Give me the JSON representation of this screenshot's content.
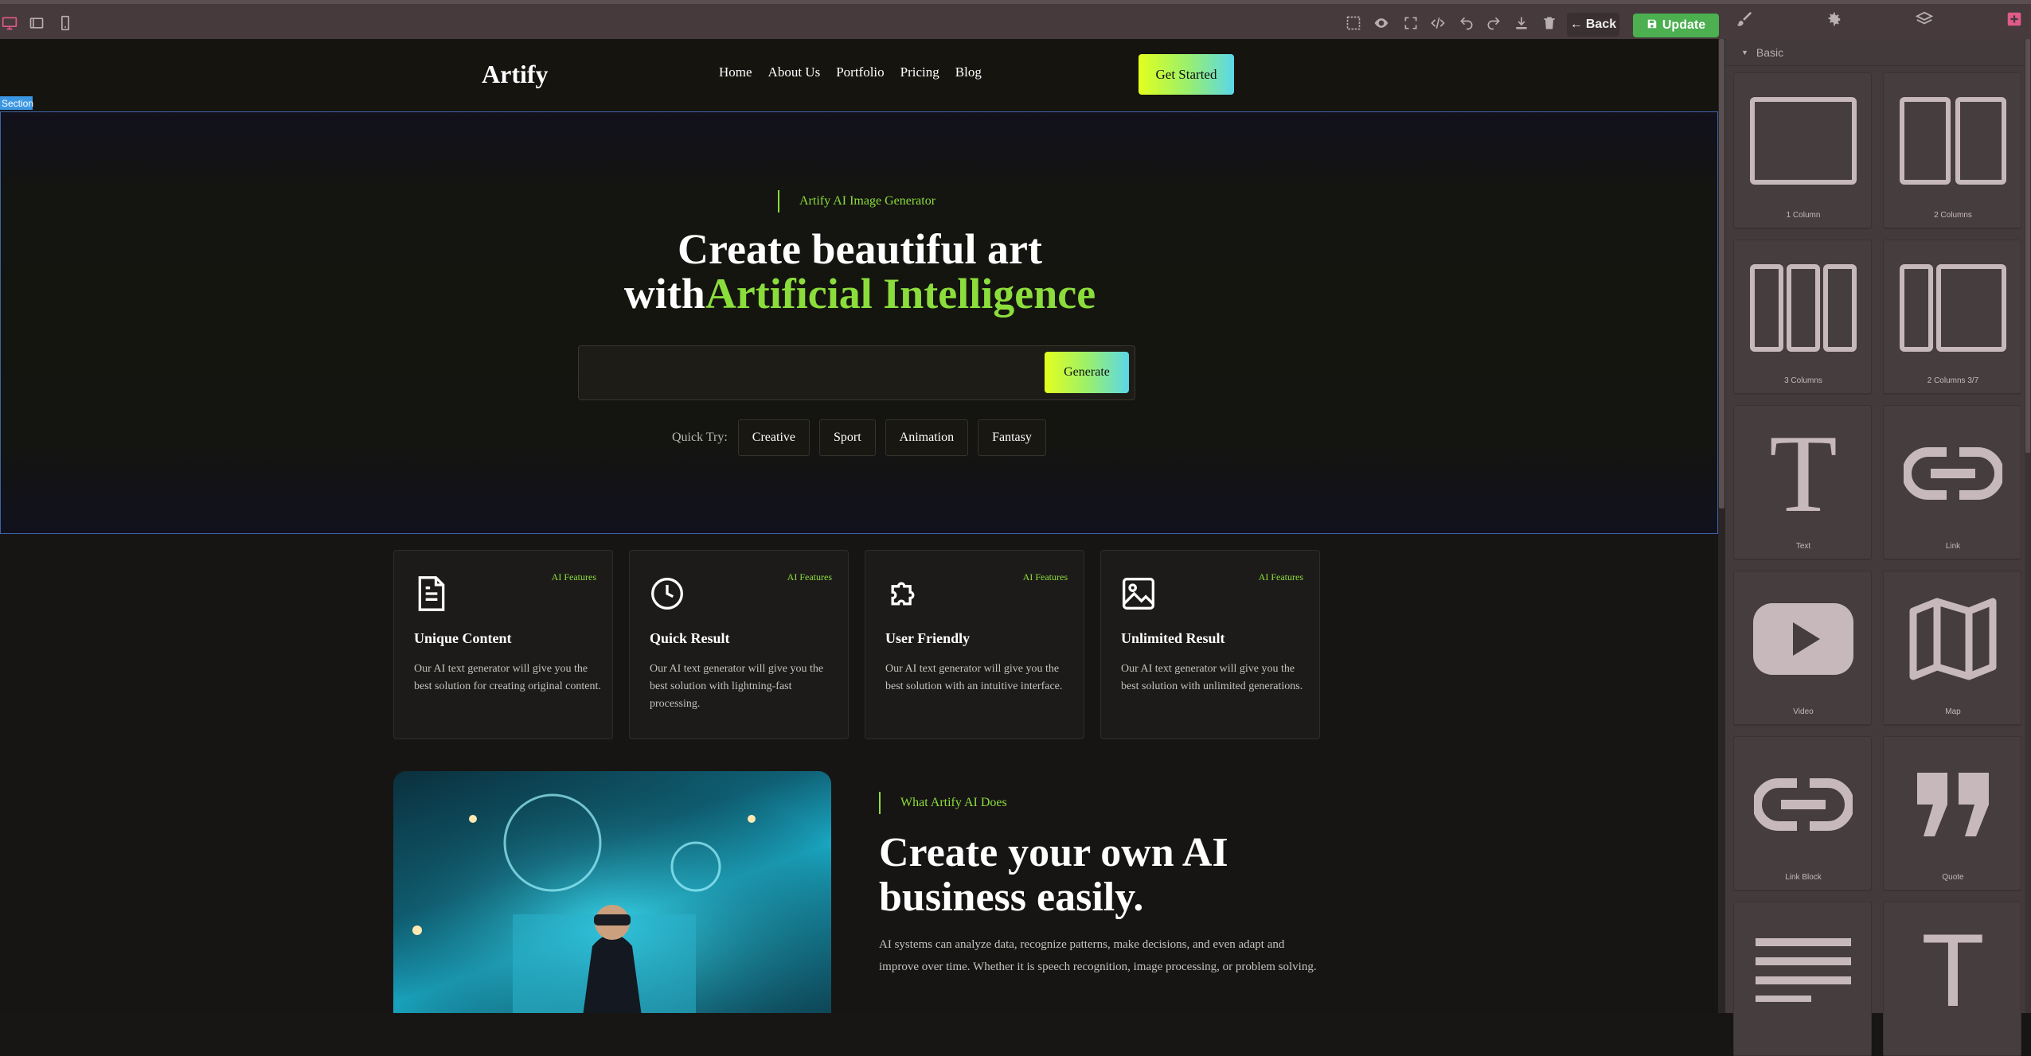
{
  "editor": {
    "back_label": "Back",
    "update_label": "Update",
    "selection_label": "Section"
  },
  "site": {
    "logo": "Artify",
    "menu": [
      "Home",
      "About Us",
      "Portfolio",
      "Pricing",
      "Blog"
    ],
    "cta": "Get Started"
  },
  "hero": {
    "eyebrow": "Artify AI Image Generator",
    "title_line1": "Create beautiful art",
    "title_with": "with",
    "title_accent": "Artificial Intelligence",
    "generate_label": "Generate",
    "quick_label": "Quick Try:",
    "chips": [
      "Creative",
      "Sport",
      "Animation",
      "Fantasy"
    ]
  },
  "features": [
    {
      "tag": "AI Features",
      "title": "Unique Content",
      "text": "Our AI text generator will give you the best solution for creating original content.",
      "icon": "file-text-icon"
    },
    {
      "tag": "AI Features",
      "title": "Quick Result",
      "text": "Our AI text generator will give you the best solution with lightning-fast processing.",
      "icon": "clock-icon"
    },
    {
      "tag": "AI Features",
      "title": "User Friendly",
      "text": "Our AI text generator will give you the best solution with an intuitive interface.",
      "icon": "puzzle-icon"
    },
    {
      "tag": "AI Features",
      "title": "Unlimited Result",
      "text": "Our AI text generator will give you the best solution with unlimited generations.",
      "icon": "image-icon"
    }
  ],
  "about": {
    "eyebrow": "What Artify AI Does",
    "title": "Create your own AI business easily.",
    "text": "AI systems can analyze data, recognize patterns, make decisions, and even adapt and improve over time. Whether it is speech recognition, image processing, or problem solving."
  },
  "panel": {
    "category": "Basic",
    "blocks": [
      "1 Column",
      "2 Columns",
      "3 Columns",
      "2 Columns 3/7",
      "Text",
      "Link",
      "Video",
      "Map",
      "Link Block",
      "Quote",
      "",
      ""
    ]
  },
  "colors": {
    "accent": "#8bdd3c",
    "update_button": "#4caf50",
    "selection": "#3b97e3",
    "panel": "#433a3b",
    "toolbar": "#463a3c"
  }
}
